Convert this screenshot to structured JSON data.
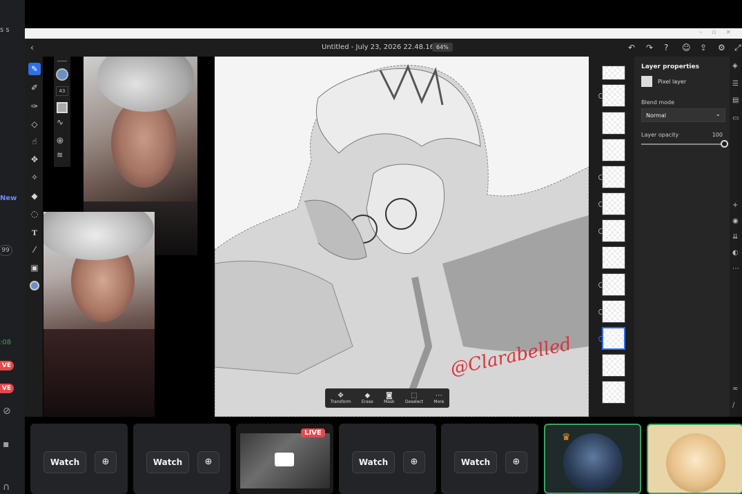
{
  "left_strip": {
    "fragment_top": "s s",
    "fragment_new": "New",
    "fragment_count": "99",
    "fragment_time": ":08",
    "live_1": "VE",
    "live_2": "VE"
  },
  "app": {
    "doc_title": "Untitled - July 23, 2026 22.48.16*",
    "zoom": "64%",
    "brush_size": "43"
  },
  "canvas": {
    "signature": "@Clarabelled"
  },
  "selection_toolbar": {
    "items": [
      {
        "label": "Transform",
        "icon": "transform-icon"
      },
      {
        "label": "Erase",
        "icon": "eraser-icon"
      },
      {
        "label": "Mask",
        "icon": "mask-icon"
      },
      {
        "label": "Deselect",
        "icon": "deselect-icon"
      },
      {
        "label": "More",
        "icon": "more-icon"
      }
    ]
  },
  "properties": {
    "title": "Layer properties",
    "layer_type": "Pixel layer",
    "blend_label": "Blend mode",
    "blend_value": "Normal",
    "opacity_label": "Layer opacity",
    "opacity_value": "100"
  },
  "stream_tiles": {
    "watch_label": "Watch",
    "live_label": "LIVE"
  },
  "colors": {
    "accent": "#2f6fe8",
    "live": "#e5484d",
    "speaking": "#3ba55d"
  }
}
